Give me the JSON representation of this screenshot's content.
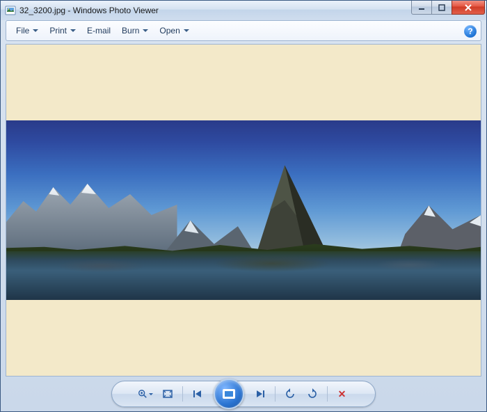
{
  "window": {
    "filename": "32_3200.jpg",
    "app_name": "Windows Photo Viewer",
    "title_sep": " - "
  },
  "menubar": {
    "file": "File",
    "print": "Print",
    "email": "E-mail",
    "burn": "Burn",
    "open": "Open",
    "help_glyph": "?"
  },
  "toolbar": {
    "zoom_label": "Zoom",
    "fit_label": "Fit to window",
    "prev_label": "Previous",
    "slideshow_label": "Play slide show",
    "next_label": "Next",
    "rotate_ccw_label": "Rotate counterclockwise",
    "rotate_cw_label": "Rotate clockwise",
    "delete_label": "Delete"
  },
  "image": {
    "description": "Panoramic mountain landscape with lake reflection"
  }
}
